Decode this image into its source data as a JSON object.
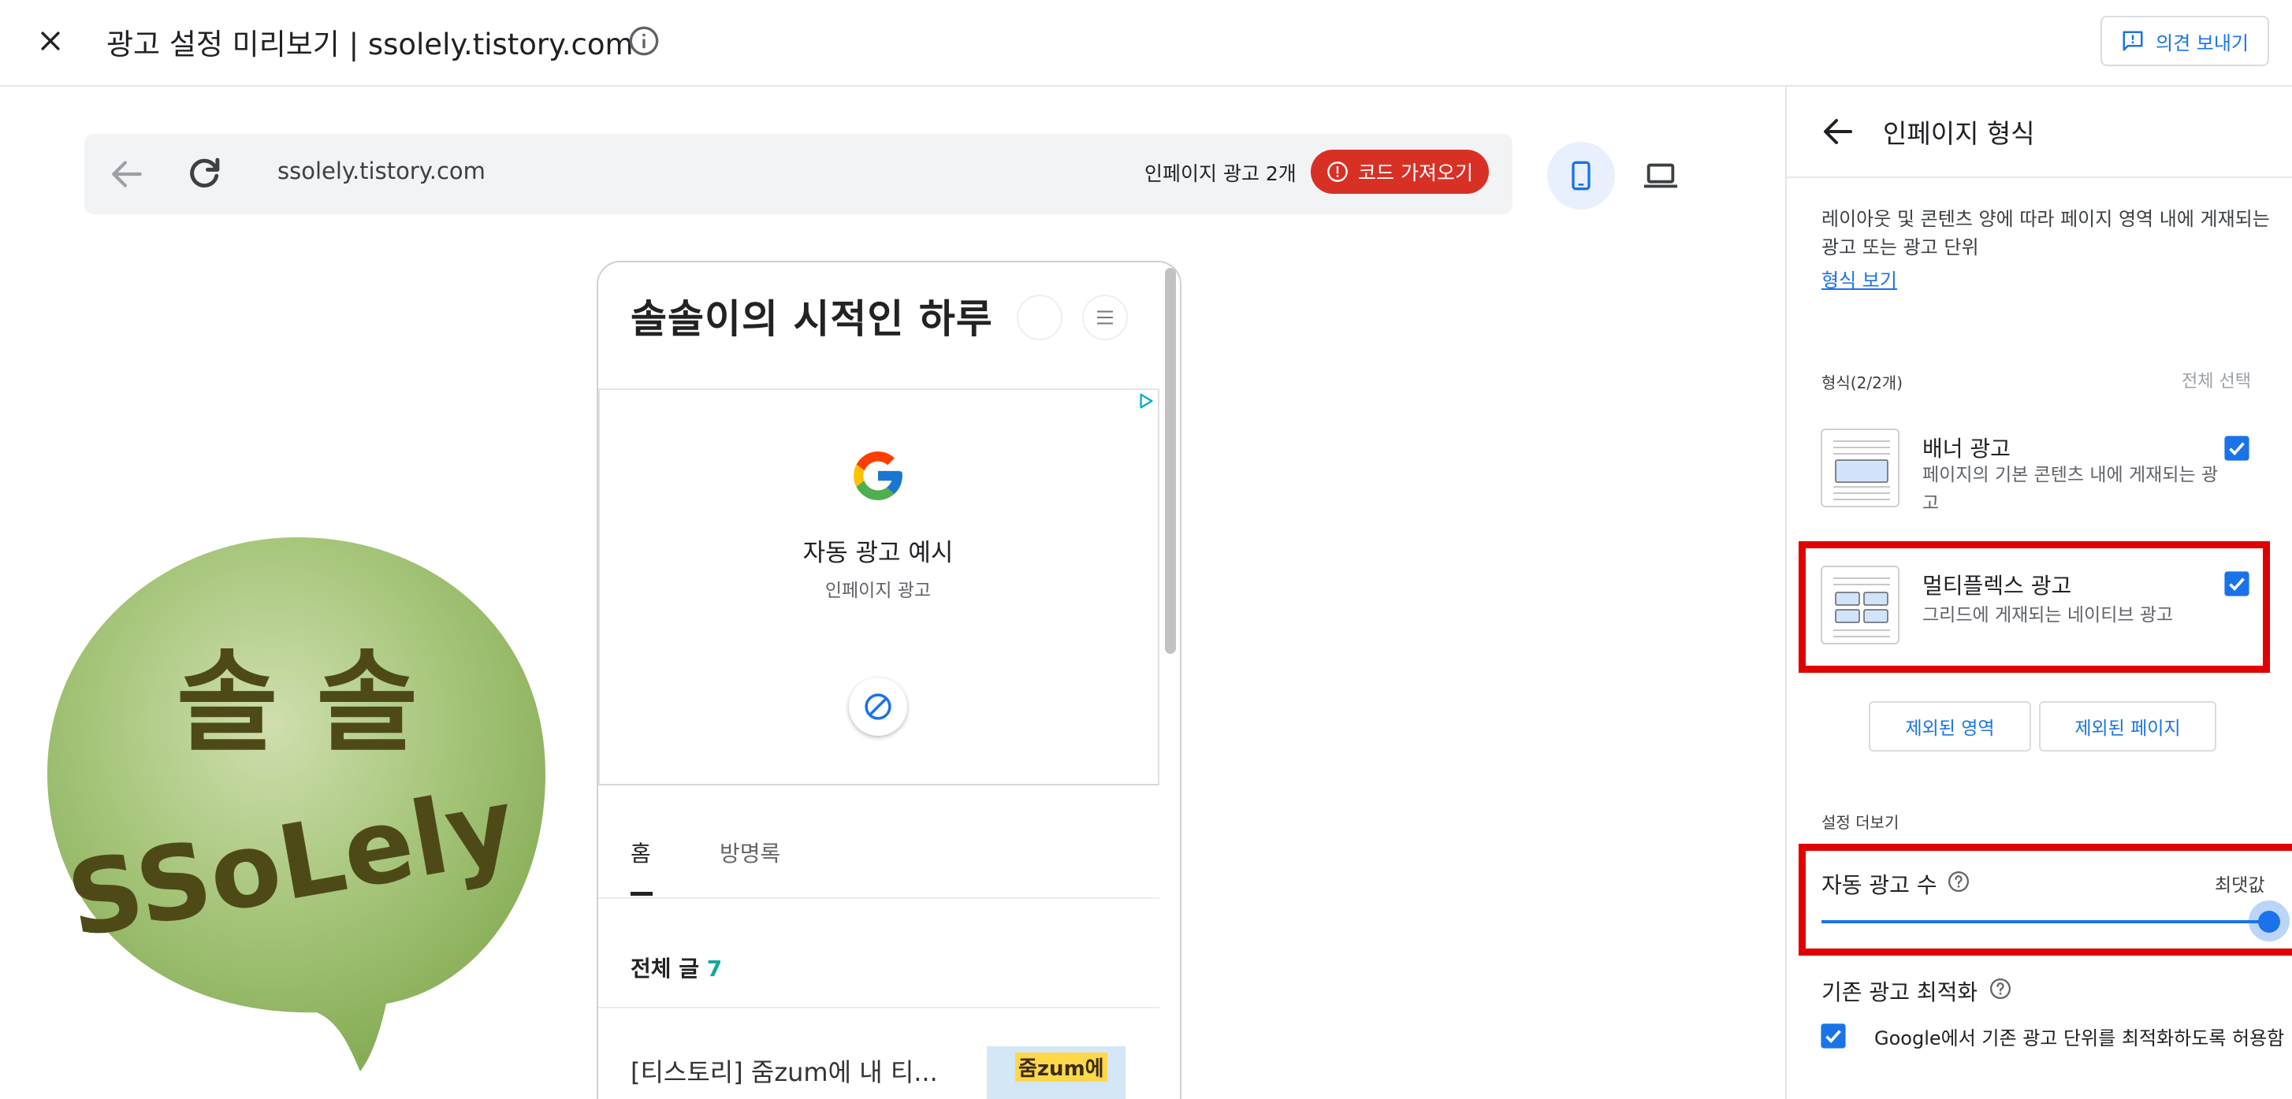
{
  "header": {
    "title": "광고 설정 미리보기 | ssolely.tistory.com",
    "feedback_label": "의견 보내기"
  },
  "preview_bar": {
    "url": "ssolely.tistory.com",
    "ad_count": "인페이지 광고 2개",
    "get_code_label": "코드 가져오기"
  },
  "blog": {
    "title": "솔솔이의 시적인 하루",
    "ad_sample_title": "자동 광고 예시",
    "ad_sample_subtitle": "인페이지 광고",
    "tabs": [
      "홈",
      "방명록"
    ],
    "all_posts_label": "전체 글",
    "all_posts_count": "7",
    "post_title": "[티스토리] 줌zum에 내 티...",
    "post_thumb_label": "줌zum에"
  },
  "logo": {
    "line1": "솔 솔",
    "line2": "SSoLely"
  },
  "panel": {
    "title": "인페이지 형식",
    "description": "레이아웃 및 콘텐츠 양에 따라 페이지 영역 내에 게재되는 광고 또는 광고 단위",
    "format_link": "형식 보기",
    "formats_heading": "형식(2/2개)",
    "select_all": "전체 선택",
    "banner": {
      "name": "배너 광고",
      "description": "페이지의 기본 콘텐츠 내에 게재되는 광고",
      "checked": true
    },
    "multiplex": {
      "name": "멀티플렉스 광고",
      "description": "그리드에 게재되는 네이티브 광고",
      "checked": true
    },
    "excluded_area_label": "제외된 영역",
    "excluded_pages_label": "제외된 페이지",
    "more_settings": "설정 더보기",
    "ad_load": {
      "label": "자동 광고 수",
      "value_label": "최댓값",
      "level": 1.0
    },
    "optimization": {
      "label": "기존 광고 최적화",
      "checkbox_text": "Google에서 기존 광고 단위를 최적화하도록 허용함",
      "checked": true
    }
  },
  "colors": {
    "accent": "#1a73e8",
    "danger": "#d93025",
    "highlight_box": "#e00000",
    "logo_green": "#9cbf6e",
    "teal_count": "#14a89b"
  },
  "icons": [
    "close-icon",
    "info-icon",
    "feedback-icon",
    "back-arrow-icon",
    "reload-icon",
    "error-icon",
    "phone-icon",
    "laptop-icon",
    "menu-icon",
    "adchoices-icon",
    "google-g-icon",
    "block-icon",
    "help-icon",
    "checkbox-icon"
  ]
}
